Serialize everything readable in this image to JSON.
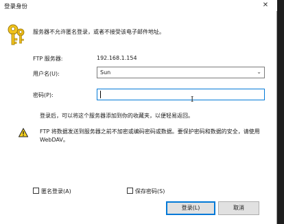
{
  "window": {
    "title": "登录身份",
    "close_glyph": "✕"
  },
  "message": "服务器不允许匿名登录，或者不接受该电子邮件地址。",
  "server": {
    "label": "FTP 服务器:",
    "value": "192.168.1.154"
  },
  "username": {
    "label": "用户名(U):",
    "value": "Sun"
  },
  "password": {
    "label": "密码(P):",
    "value": ""
  },
  "hint": "登录后，可以将这个服务器添加到你的收藏夹，以便轻易返回。",
  "warning": {
    "line1": "FTP 将数据发送到服务器之前不加密或编码密码或数据。要保护密码和数据的安全，请使用",
    "line2": "WebDAV。"
  },
  "checkboxes": {
    "anonymous": {
      "label": "匿名登录(A)",
      "checked": false
    },
    "save_password": {
      "label": "保存密码(S)",
      "checked": false
    }
  },
  "buttons": {
    "login": "登录(L)",
    "cancel": "取消"
  },
  "colors": {
    "accent": "#0078d7",
    "warning_fill": "#f7d21e"
  }
}
